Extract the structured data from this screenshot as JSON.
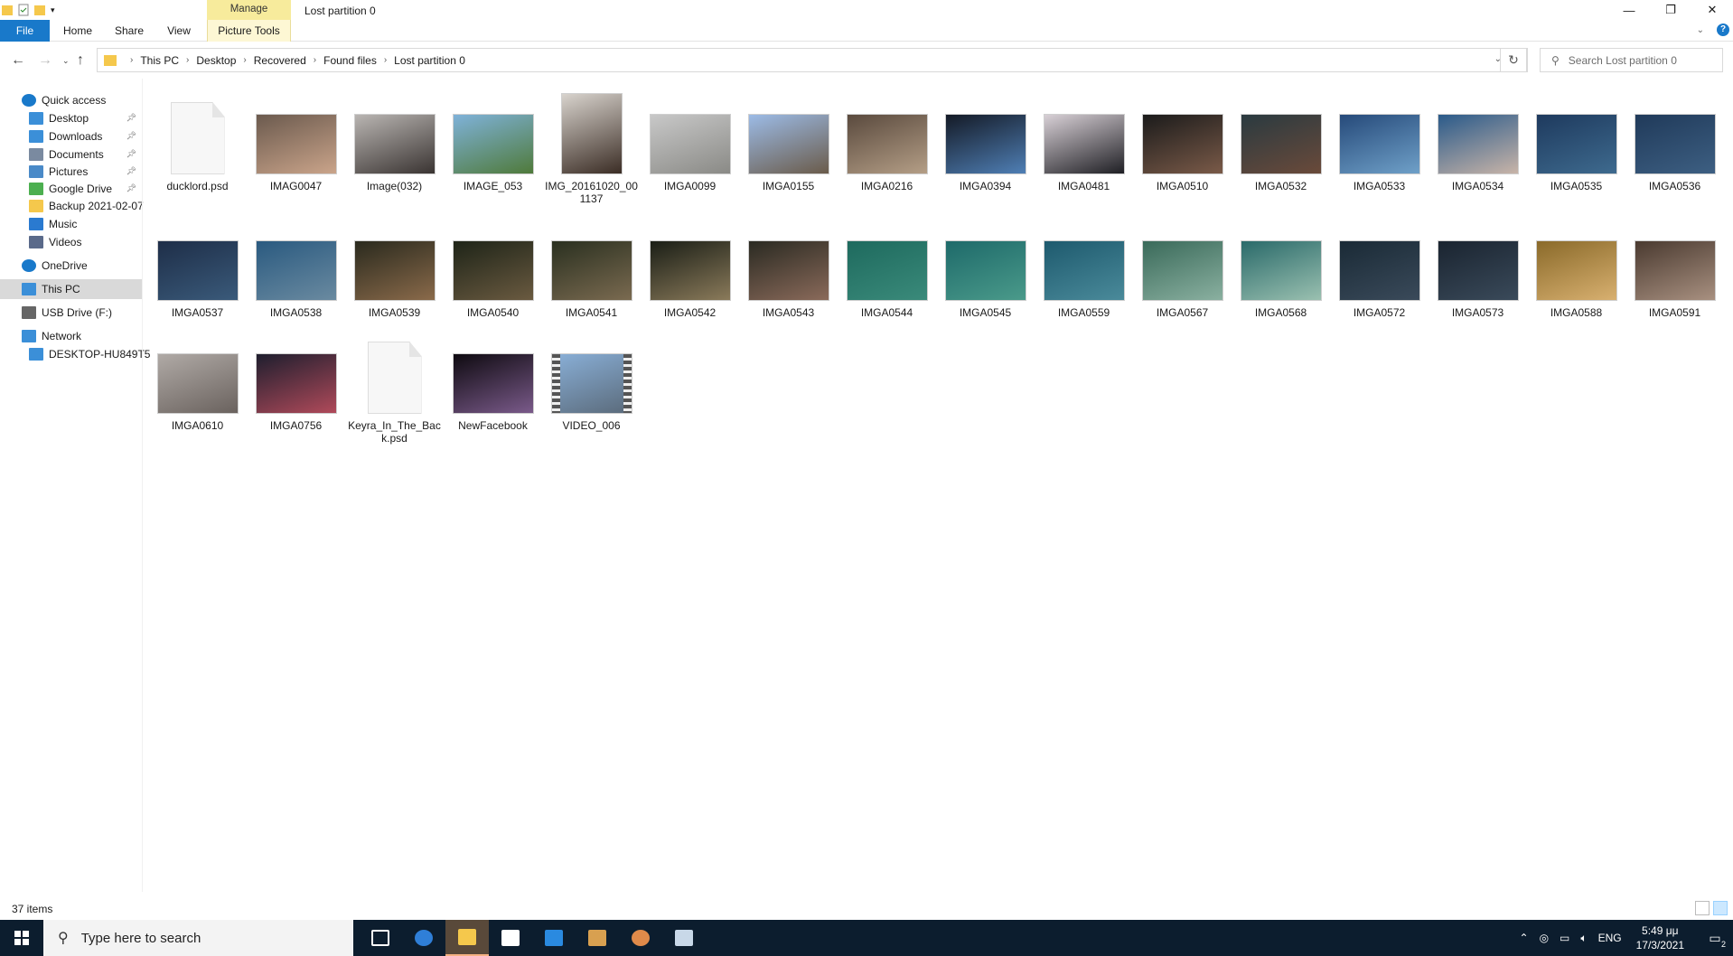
{
  "window": {
    "title": "Lost partition 0",
    "contextual_group": "Manage"
  },
  "ribbon": {
    "tabs": [
      "File",
      "Home",
      "Share",
      "View",
      "Picture Tools"
    ]
  },
  "address": {
    "breadcrumbs": [
      "This PC",
      "Desktop",
      "Recovered",
      "Found files",
      "Lost partition 0"
    ],
    "search_placeholder": "Search Lost partition 0"
  },
  "nav": {
    "items": [
      {
        "label": "Quick access",
        "icon": "star-icon",
        "level": 0,
        "pinned": false,
        "selected": false
      },
      {
        "label": "Desktop",
        "icon": "desktop-icon",
        "level": 1,
        "pinned": true,
        "selected": false
      },
      {
        "label": "Downloads",
        "icon": "download-icon",
        "level": 1,
        "pinned": true,
        "selected": false
      },
      {
        "label": "Documents",
        "icon": "documents-icon",
        "level": 1,
        "pinned": true,
        "selected": false
      },
      {
        "label": "Pictures",
        "icon": "pictures-icon",
        "level": 1,
        "pinned": true,
        "selected": false
      },
      {
        "label": "Google Drive",
        "icon": "google-drive-icon",
        "level": 1,
        "pinned": true,
        "selected": false
      },
      {
        "label": "Backup 2021-02-07",
        "icon": "folder-icon",
        "level": 1,
        "pinned": false,
        "selected": false
      },
      {
        "label": "Music",
        "icon": "music-icon",
        "level": 1,
        "pinned": false,
        "selected": false
      },
      {
        "label": "Videos",
        "icon": "videos-icon",
        "level": 1,
        "pinned": false,
        "selected": false
      },
      {
        "label": "OneDrive",
        "icon": "cloud-icon",
        "level": 0,
        "pinned": false,
        "selected": false
      },
      {
        "label": "This PC",
        "icon": "computer-icon",
        "level": 0,
        "pinned": false,
        "selected": true
      },
      {
        "label": "USB Drive (F:)",
        "icon": "usb-drive-icon",
        "level": 0,
        "pinned": false,
        "selected": false
      },
      {
        "label": "Network",
        "icon": "network-icon",
        "level": 0,
        "pinned": false,
        "selected": false
      },
      {
        "label": "DESKTOP-HU849T5",
        "icon": "computer-icon",
        "level": 1,
        "pinned": false,
        "selected": false
      }
    ]
  },
  "files": [
    {
      "name": "ducklord.psd",
      "kind": "doc"
    },
    {
      "name": "IMAG0047",
      "kind": "img",
      "colors": [
        "#6b5a4e",
        "#caa48a"
      ]
    },
    {
      "name": "Image(032)",
      "kind": "img",
      "colors": [
        "#b9b5b2",
        "#3a3432"
      ]
    },
    {
      "name": "IMAGE_053",
      "kind": "img",
      "colors": [
        "#7fb2d9",
        "#4f7a3a"
      ]
    },
    {
      "name": "IMG_20161020_001137",
      "kind": "img",
      "colors": [
        "#d8d3cd",
        "#3b2d25"
      ],
      "tall": true
    },
    {
      "name": "IMGA0099",
      "kind": "img",
      "colors": [
        "#c8c8c8",
        "#8a8a86"
      ]
    },
    {
      "name": "IMGA0155",
      "kind": "img",
      "colors": [
        "#9cbbe6",
        "#6a5b4a"
      ]
    },
    {
      "name": "IMGA0216",
      "kind": "img",
      "colors": [
        "#5a4a3e",
        "#b49e86"
      ]
    },
    {
      "name": "IMGA0394",
      "kind": "img",
      "colors": [
        "#141a26",
        "#4f7fb5"
      ]
    },
    {
      "name": "IMGA0481",
      "kind": "img",
      "colors": [
        "#d8d0d6",
        "#1f1f24"
      ]
    },
    {
      "name": "IMGA0510",
      "kind": "img",
      "colors": [
        "#1b1b1b",
        "#7a5a48"
      ]
    },
    {
      "name": "IMGA0532",
      "kind": "img",
      "colors": [
        "#2a3a40",
        "#6a4a3a"
      ]
    },
    {
      "name": "IMGA0533",
      "kind": "img",
      "colors": [
        "#264a7a",
        "#6fa0c8"
      ]
    },
    {
      "name": "IMGA0534",
      "kind": "img",
      "colors": [
        "#2a5a8a",
        "#c8b4a8"
      ]
    },
    {
      "name": "IMGA0535",
      "kind": "img",
      "colors": [
        "#1e3a5e",
        "#3e6a8e"
      ]
    },
    {
      "name": "IMGA0536",
      "kind": "img",
      "colors": [
        "#203a5a",
        "#3d5f82"
      ]
    },
    {
      "name": "IMGA0537",
      "kind": "img",
      "colors": [
        "#1e2e48",
        "#3a5a7a"
      ]
    },
    {
      "name": "IMGA0538",
      "kind": "img",
      "colors": [
        "#2a5a80",
        "#6a8aa0"
      ]
    },
    {
      "name": "IMGA0539",
      "kind": "img",
      "colors": [
        "#2a2a1e",
        "#8a6a4a"
      ]
    },
    {
      "name": "IMGA0540",
      "kind": "img",
      "colors": [
        "#1e2418",
        "#6a5a40"
      ]
    },
    {
      "name": "IMGA0541",
      "kind": "img",
      "colors": [
        "#2a3020",
        "#7a6a50"
      ]
    },
    {
      "name": "IMGA0542",
      "kind": "img",
      "colors": [
        "#1a1e16",
        "#8a7a5a"
      ]
    },
    {
      "name": "IMGA0543",
      "kind": "img",
      "colors": [
        "#2a2a22",
        "#8a6a5a"
      ]
    },
    {
      "name": "IMGA0544",
      "kind": "img",
      "colors": [
        "#1e6a5e",
        "#3a8a7a"
      ]
    },
    {
      "name": "IMGA0545",
      "kind": "img",
      "colors": [
        "#1e6a6a",
        "#4a9a8a"
      ]
    },
    {
      "name": "IMGA0559",
      "kind": "img",
      "colors": [
        "#1e5a6e",
        "#4a8a9a"
      ]
    },
    {
      "name": "IMGA0567",
      "kind": "img",
      "colors": [
        "#3a6a5a",
        "#8ab0a0"
      ]
    },
    {
      "name": "IMGA0568",
      "kind": "img",
      "colors": [
        "#2a6a6a",
        "#9ac0b0"
      ]
    },
    {
      "name": "IMGA0572",
      "kind": "img",
      "colors": [
        "#1a2a36",
        "#3a4a5a"
      ]
    },
    {
      "name": "IMGA0573",
      "kind": "img",
      "colors": [
        "#1a2430",
        "#3a4a5a"
      ]
    },
    {
      "name": "IMGA0588",
      "kind": "img",
      "colors": [
        "#8a6a2a",
        "#d8b070"
      ]
    },
    {
      "name": "IMGA0591",
      "kind": "img",
      "colors": [
        "#4a3a30",
        "#a89080"
      ]
    },
    {
      "name": "IMGA0610",
      "kind": "img",
      "colors": [
        "#b0aaa6",
        "#6a625e"
      ]
    },
    {
      "name": "IMGA0756",
      "kind": "img",
      "colors": [
        "#1e1e2e",
        "#b04a5a"
      ]
    },
    {
      "name": "Keyra_In_The_Back.psd",
      "kind": "doc"
    },
    {
      "name": "NewFacebook",
      "kind": "img",
      "colors": [
        "#0e0a10",
        "#7a5a8a"
      ]
    },
    {
      "name": "VIDEO_006",
      "kind": "video",
      "colors": [
        "#8ab0d8",
        "#5a6a7a"
      ]
    }
  ],
  "status": {
    "item_count": "37 items"
  },
  "taskbar": {
    "search_placeholder": "Type here to search",
    "apps": [
      "task-view-icon",
      "edge-icon",
      "file-explorer-icon",
      "store-icon",
      "mail-icon",
      "photos-icon",
      "app-orange-icon",
      "app-window-icon"
    ],
    "language": "ENG",
    "time": "5:49 μμ",
    "date": "17/3/2021",
    "notifications": "2"
  }
}
